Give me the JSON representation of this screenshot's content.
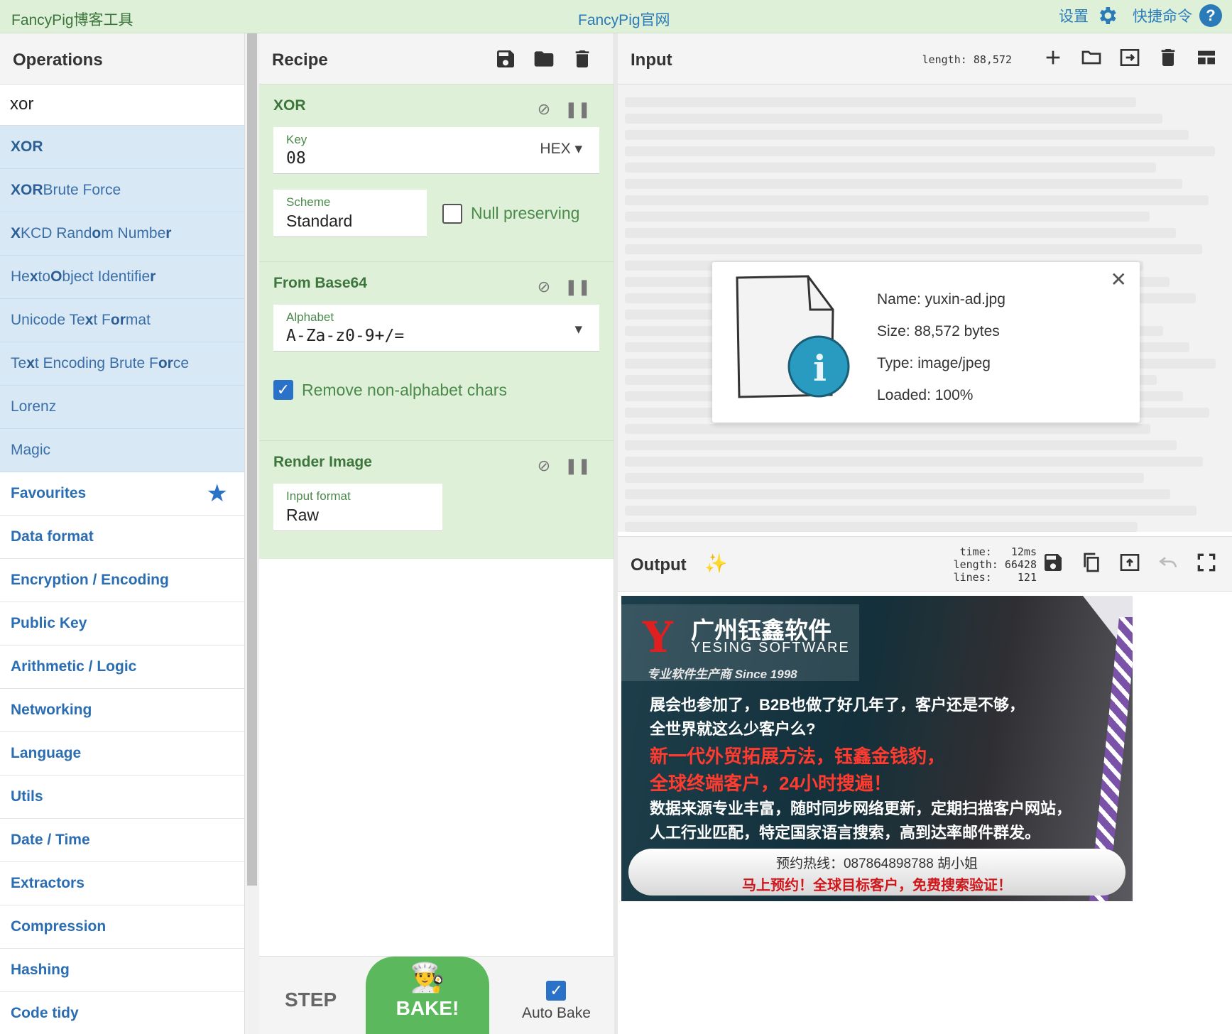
{
  "topbar": {
    "left": "FancyPig博客工具",
    "center": "FancyPig官网",
    "settings": "设置",
    "commands": "快捷命令",
    "help_icon": "help-icon",
    "gear_icon": "gear-icon"
  },
  "operations": {
    "title": "Operations",
    "search_value": "xor",
    "results": [
      {
        "pre": "",
        "bold": "XOR",
        "post": ""
      },
      {
        "pre": "",
        "bold": "XOR",
        "post": " Brute Force"
      },
      {
        "pre": "",
        "bold": "X",
        "post": "KCD Rand",
        "bold2": "o",
        "post2": "m Numbe",
        "bold3": "r",
        "post3": ""
      },
      {
        "pre": "He",
        "bold": "x",
        "post": " to ",
        "bold2": "O",
        "post2": "bject Identifie",
        "bold3": "r",
        "post3": ""
      },
      {
        "pre": "Unicode Te",
        "bold": "x",
        "post": "t F",
        "bold2": "o",
        "post2": "",
        "bold3": "r",
        "post3": "mat"
      },
      {
        "pre": "Te",
        "bold": "x",
        "post": "t Encoding Brute F",
        "bold2": "o",
        "post2": "",
        "bold3": "r",
        "post3": "ce"
      },
      {
        "pre": "Lorenz",
        "bold": "",
        "post": ""
      },
      {
        "pre": "Magic",
        "bold": "",
        "post": ""
      }
    ],
    "categories": [
      "Favourites",
      "Data format",
      "Encryption / Encoding",
      "Public Key",
      "Arithmetic / Logic",
      "Networking",
      "Language",
      "Utils",
      "Date / Time",
      "Extractors",
      "Compression",
      "Hashing",
      "Code tidy"
    ]
  },
  "recipe": {
    "title": "Recipe",
    "ops": {
      "xor": {
        "title": "XOR",
        "key_label": "Key",
        "key_value": "08",
        "key_format": "HEX",
        "scheme_label": "Scheme",
        "scheme_value": "Standard",
        "null_label": "Null preserving",
        "null_checked": false
      },
      "b64": {
        "title": "From Base64",
        "alphabet_label": "Alphabet",
        "alphabet_value": "A-Za-z0-9+/=",
        "remove_label": "Remove non-alphabet chars",
        "remove_checked": true
      },
      "render": {
        "title": "Render Image",
        "format_label": "Input format",
        "format_value": "Raw"
      }
    },
    "footer": {
      "step": "STEP",
      "bake": "BAKE!",
      "autobake": "Auto Bake"
    }
  },
  "input": {
    "title": "Input",
    "length_label": "length:",
    "length_value": "88,572",
    "file": {
      "name": "Name: yuxin-ad.jpg",
      "size": "Size: 88,572 bytes",
      "type": "Type: image/jpeg",
      "loaded": "Loaded: 100%"
    }
  },
  "output": {
    "title": "Output",
    "stats": "time:   12ms\nlength: 66428\nlines:    121",
    "banner": {
      "company": "广州钰鑫软件",
      "english": "YESING SOFTWARE",
      "slogan": "专业软件生产商  Since 1998",
      "line1": "展会也参加了，B2B也做了好几年了，客户还是不够，",
      "line2": "全世界就这么少客户么?",
      "red1": "新一代外贸拓展方法，钰鑫金钱豹，",
      "red2": "全球终端客户，24小时搜遍！",
      "line3": "数据来源专业丰富，随时同步网络更新，定期扫描客户网站，",
      "line4": "人工行业匹配，特定国家语言搜索，高到达率邮件群发。",
      "hotline": "预约热线：087864898788  胡小姐",
      "cta": "马上预约！全球目标客户，免费搜索验证！"
    }
  }
}
